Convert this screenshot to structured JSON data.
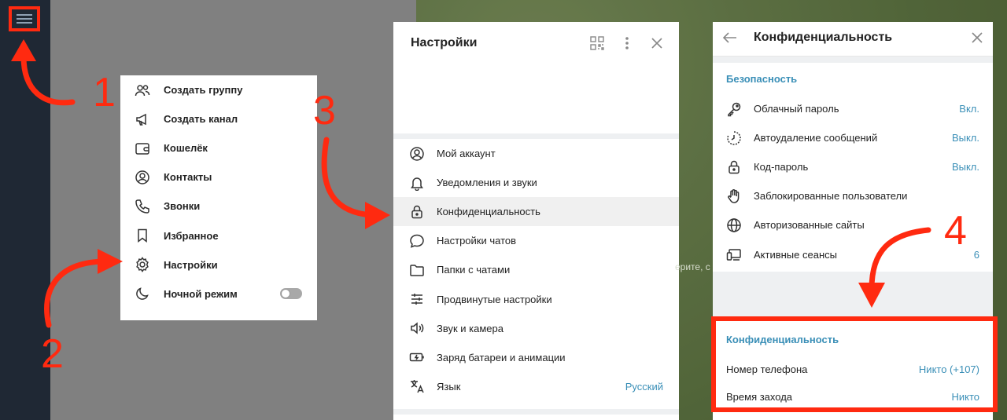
{
  "menu": {
    "items": [
      {
        "label": "Создать группу",
        "icon": "group-icon"
      },
      {
        "label": "Создать канал",
        "icon": "megaphone-icon"
      },
      {
        "label": "Кошелёк",
        "icon": "wallet-icon"
      },
      {
        "label": "Контакты",
        "icon": "contact-icon"
      },
      {
        "label": "Звонки",
        "icon": "phone-icon"
      },
      {
        "label": "Избранное",
        "icon": "bookmark-icon"
      },
      {
        "label": "Настройки",
        "icon": "gear-icon"
      },
      {
        "label": "Ночной режим",
        "icon": "moon-icon",
        "toggle": false
      }
    ]
  },
  "settings": {
    "title": "Настройки",
    "items": [
      {
        "label": "Мой аккаунт",
        "icon": "account-icon"
      },
      {
        "label": "Уведомления и звуки",
        "icon": "bell-icon"
      },
      {
        "label": "Конфиденциальность",
        "icon": "lock-icon"
      },
      {
        "label": "Настройки чатов",
        "icon": "chat-bubble-icon"
      },
      {
        "label": "Папки с чатами",
        "icon": "folder-icon"
      },
      {
        "label": "Продвинутые настройки",
        "icon": "sliders-icon"
      },
      {
        "label": "Звук и камера",
        "icon": "speaker-icon"
      },
      {
        "label": "Заряд батареи и анимации",
        "icon": "battery-icon"
      },
      {
        "label": "Язык",
        "icon": "translate-icon",
        "value": "Русский"
      }
    ]
  },
  "privacy": {
    "title": "Конфиденциальность",
    "security_label": "Безопасность",
    "security_items": [
      {
        "label": "Облачный пароль",
        "icon": "key-icon",
        "value": "Вкл."
      },
      {
        "label": "Автоудаление сообщений",
        "icon": "timer-icon",
        "value": "Выкл."
      },
      {
        "label": "Код-пароль",
        "icon": "lock-icon",
        "value": "Выкл."
      },
      {
        "label": "Заблокированные пользователи",
        "icon": "hand-icon",
        "value": ""
      },
      {
        "label": "Авторизованные сайты",
        "icon": "globe-icon",
        "value": ""
      },
      {
        "label": "Активные сеансы",
        "icon": "devices-icon",
        "value": "6"
      }
    ],
    "privacy_label": "Конфиденциальность",
    "privacy_items": [
      {
        "label": "Номер телефона",
        "value": "Никто (+107)"
      },
      {
        "label": "Время захода",
        "value": "Никто"
      }
    ]
  },
  "chat_hint": "ерите, с",
  "annotations": {
    "n1": "1",
    "n2": "2",
    "n3": "3",
    "n4": "4"
  },
  "colors": {
    "accent": "#3a8fb7",
    "annotation": "#ff2a10"
  }
}
